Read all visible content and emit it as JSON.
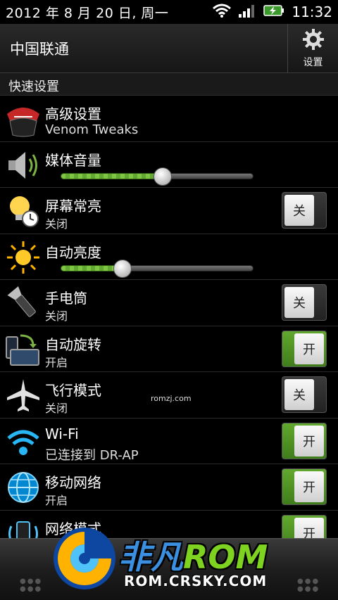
{
  "status_bar": {
    "date": "2012 年 8 月 20 日, 周一",
    "time": "11:32",
    "icons": [
      "wifi-icon",
      "signal-icon",
      "battery-charging-icon"
    ]
  },
  "header": {
    "carrier": "中国联通",
    "settings_label": "设置"
  },
  "section_title": "快速设置",
  "rows": [
    {
      "title": "高级设置",
      "subtitle": "Venom Tweaks",
      "icon": "venom-icon",
      "control": "none"
    },
    {
      "title": "媒体音量",
      "icon": "speaker-icon",
      "control": "slider",
      "value": 0.53
    },
    {
      "title": "屏幕常亮",
      "subtitle": "关闭",
      "icon": "bulb-clock-icon",
      "control": "toggle",
      "state": "off",
      "toggle_label": "关"
    },
    {
      "title": "自动亮度",
      "icon": "sun-icon",
      "control": "slider",
      "value": 0.32
    },
    {
      "title": "手电筒",
      "subtitle": "关闭",
      "icon": "flashlight-icon",
      "control": "toggle",
      "state": "off",
      "toggle_label": "关"
    },
    {
      "title": "自动旋转",
      "subtitle": "开启",
      "icon": "rotate-icon",
      "control": "toggle",
      "state": "on",
      "toggle_label": "开"
    },
    {
      "title": "飞行模式",
      "subtitle": "关闭",
      "icon": "airplane-icon",
      "control": "toggle",
      "state": "off",
      "toggle_label": "关"
    },
    {
      "title": "Wi-Fi",
      "subtitle": "已连接到 DR-AP",
      "icon": "wifi-icon",
      "control": "toggle",
      "state": "on",
      "toggle_label": "开"
    },
    {
      "title": "移动网络",
      "subtitle": "开启",
      "icon": "globe-icon",
      "control": "toggle",
      "state": "on",
      "toggle_label": "开"
    },
    {
      "title": "网络模式",
      "icon": "network-mode-icon",
      "control": "toggle",
      "state": "on",
      "toggle_label": "开"
    }
  ],
  "watermark_small": "romzj.com",
  "logo": {
    "brand_a": "非凡",
    "brand_b": "ROM",
    "url": "ROM.CRSKY.COM"
  },
  "colors": {
    "accent_green": "#62a82f",
    "background": "#000000"
  }
}
